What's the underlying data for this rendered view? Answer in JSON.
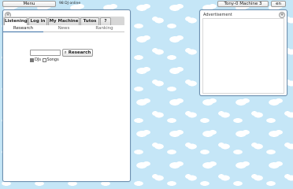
{
  "topbar": {
    "menu_label": "Menu",
    "online_text": "98 DJ online",
    "machine_label": "Tony-0 Machine 3",
    "lang_label": "en"
  },
  "main_panel": {
    "tabs": [
      {
        "label": "Listening",
        "active": true
      },
      {
        "label": "Log in",
        "active": false
      },
      {
        "label": "My Machine",
        "active": false
      },
      {
        "label": "Tutos",
        "active": false
      },
      {
        "label": "?",
        "active": false
      }
    ],
    "subtabs": [
      {
        "label": "Research",
        "active": true
      },
      {
        "label": "News",
        "active": false
      },
      {
        "label": "Ranking",
        "active": false
      }
    ],
    "search": {
      "value": "",
      "placeholder": "",
      "button_label": "Research"
    },
    "filters": [
      {
        "label": "DJs",
        "checked": true
      },
      {
        "label": "Songs",
        "checked": false
      }
    ]
  },
  "ad_panel": {
    "title": "Advertisement"
  },
  "icons": {
    "panel_corner": "settings-icon",
    "search_button": "search-icon"
  },
  "colors": {
    "background": "#c5e6f7",
    "panel_border": "#6c8fb0",
    "active_underline": "#3a6fa5"
  }
}
